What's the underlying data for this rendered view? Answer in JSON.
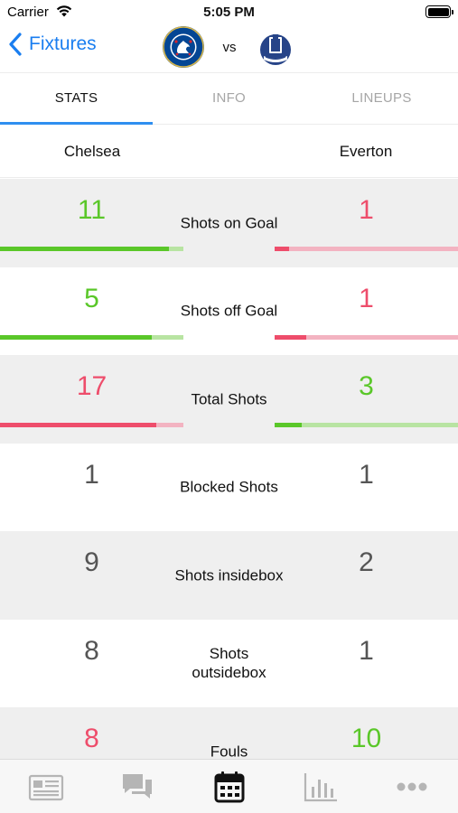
{
  "status_bar": {
    "carrier": "Carrier",
    "time": "5:05 PM"
  },
  "nav": {
    "back_label": "Fixtures",
    "vs": "vs",
    "home_crest_icon": "chelsea-crest-icon",
    "away_crest_icon": "everton-crest-icon"
  },
  "tabs": [
    {
      "label": "STATS",
      "active": true
    },
    {
      "label": "INFO",
      "active": false
    },
    {
      "label": "LINEUPS",
      "active": false
    }
  ],
  "teams": {
    "home": "Chelsea",
    "away": "Everton"
  },
  "colors": {
    "accent": "#1a7ef0",
    "green": "#5ac729",
    "green_light": "#b8e4a2",
    "red": "#ee4d6b",
    "red_light": "#f3b3c1",
    "neutral": "#555555",
    "tab_icon": "#b5b5b5",
    "tab_icon_active": "#111111"
  },
  "stats": [
    {
      "label": "Shots on Goal",
      "home": "11",
      "away": "1",
      "home_state": "win",
      "away_state": "lose",
      "home_share": 0.92,
      "away_share": 0.08
    },
    {
      "label": "Shots off Goal",
      "home": "5",
      "away": "1",
      "home_state": "win",
      "away_state": "lose",
      "home_share": 0.83,
      "away_share": 0.17
    },
    {
      "label": "Total Shots",
      "home": "17",
      "away": "3",
      "home_state": "lose",
      "away_state": "win",
      "home_share": 0.85,
      "away_share": 0.15
    },
    {
      "label": "Blocked Shots",
      "home": "1",
      "away": "1",
      "home_state": "neutral",
      "away_state": "neutral"
    },
    {
      "label": "Shots insidebox",
      "home": "9",
      "away": "2",
      "home_state": "neutral",
      "away_state": "neutral"
    },
    {
      "label": "Shots outsidebox",
      "home": "8",
      "away": "1",
      "home_state": "neutral",
      "away_state": "neutral"
    },
    {
      "label": "Fouls",
      "home": "8",
      "away": "10",
      "home_state": "lose",
      "away_state": "win"
    }
  ],
  "tab_bar": [
    {
      "name": "news-icon",
      "active": false
    },
    {
      "name": "chat-icon",
      "active": false
    },
    {
      "name": "calendar-icon",
      "active": true
    },
    {
      "name": "stats-icon",
      "active": false
    },
    {
      "name": "more-icon",
      "active": false
    }
  ]
}
